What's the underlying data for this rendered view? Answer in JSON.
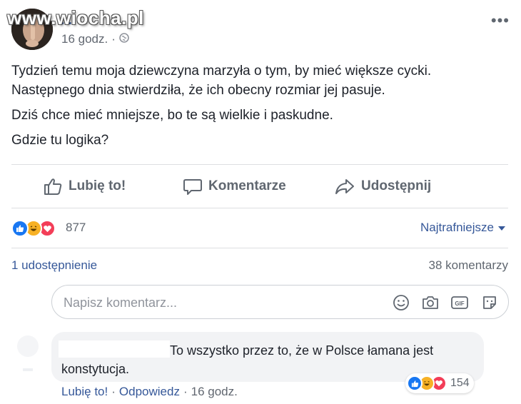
{
  "colors": {
    "link": "#365899",
    "muted": "#606770",
    "text": "#1d2129",
    "like": "#1877f2",
    "love": "#f33e58",
    "haha": "#f7b125"
  },
  "post": {
    "author": "...",
    "watermark": "www.wiocha.pl",
    "time": "16 godz.",
    "separator": "·",
    "audience_icon": "globe-icon",
    "more_label": "•••",
    "paragraphs": [
      "Tydzień temu moja dziewczyna marzyła o tym, by mieć większe cycki. Następnego dnia stwierdziła, że ich obecny rozmiar jej pasuje.",
      "Dziś chce mieć mniejsze, bo te są wielkie i paskudne.",
      "Gdzie tu logika?"
    ]
  },
  "actions": {
    "like": "Lubię to!",
    "comment": "Komentarze",
    "share": "Udostępnij"
  },
  "reactions": {
    "icons": [
      "like-reaction-icon",
      "haha-reaction-icon",
      "love-reaction-icon"
    ],
    "count": "877",
    "sort_label": "Najtrafniejsze"
  },
  "counts": {
    "shares": "1 udostępnienie",
    "comments": "38 komentarzy"
  },
  "comment_box": {
    "placeholder": "Napisz komentarz...",
    "icons": [
      "emoji-icon",
      "camera-icon",
      "gif-icon",
      "sticker-icon"
    ]
  },
  "reply": {
    "text": "To wszystko przez to, że w Polsce łamana jest konstytucja.",
    "reaction_count": "154",
    "like_link": "Lubię to!",
    "reply_link": "Odpowiedz",
    "separator": "·",
    "time": "16 godz."
  }
}
